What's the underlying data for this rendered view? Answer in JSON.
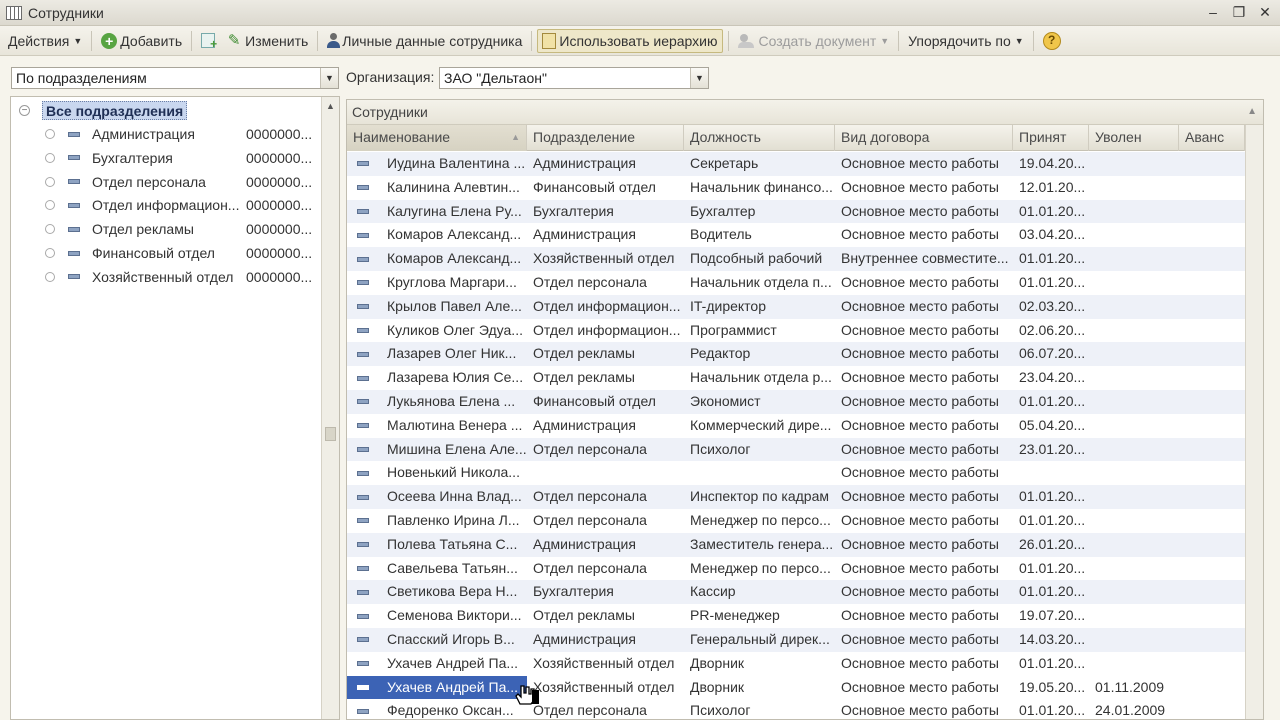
{
  "window": {
    "title": "Сотрудники"
  },
  "toolbar": {
    "actions": "Действия",
    "add": "Добавить",
    "edit": "Изменить",
    "personal_data": "Личные данные сотрудника",
    "use_hierarchy": "Использовать иерархию",
    "create_document": "Создать документ",
    "order_by": "Упорядочить по"
  },
  "filters": {
    "view_mode": "По подразделениям",
    "org_label": "Организация:",
    "org_value": "ЗАО \"Дельтаон\""
  },
  "tree": {
    "root": "Все подразделения",
    "items": [
      {
        "name": "Администрация",
        "code": "0000000..."
      },
      {
        "name": "Бухгалтерия",
        "code": "0000000..."
      },
      {
        "name": "Отдел персонала",
        "code": "0000000..."
      },
      {
        "name": "Отдел информацион...",
        "code": "0000000..."
      },
      {
        "name": "Отдел рекламы",
        "code": "0000000..."
      },
      {
        "name": "Финансовый отдел",
        "code": "0000000..."
      },
      {
        "name": "Хозяйственный отдел",
        "code": "0000000..."
      }
    ]
  },
  "grid": {
    "caption": "Сотрудники",
    "columns": [
      "Наименование",
      "Подразделение",
      "Должность",
      "Вид договора",
      "Принят",
      "Уволен",
      "Аванс"
    ],
    "rows": [
      [
        "Иудина Валентина ...",
        "Администрация",
        "Секретарь",
        "Основное место работы",
        "19.04.20...",
        "",
        ""
      ],
      [
        "Калинина Алевтин...",
        "Финансовый отдел",
        "Начальник финансо...",
        "Основное место работы",
        "12.01.20...",
        "",
        ""
      ],
      [
        "Калугина Елена Ру...",
        "Бухгалтерия",
        "Бухгалтер",
        "Основное место работы",
        "01.01.20...",
        "",
        ""
      ],
      [
        "Комаров Александ...",
        "Администрация",
        "Водитель",
        "Основное место работы",
        "03.04.20...",
        "",
        ""
      ],
      [
        "Комаров Александ...",
        "Хозяйственный отдел",
        "Подсобный рабочий",
        "Внутреннее совместите...",
        "01.01.20...",
        "",
        ""
      ],
      [
        "Круглова Маргари...",
        "Отдел персонала",
        "Начальник отдела п...",
        "Основное место работы",
        "01.01.20...",
        "",
        ""
      ],
      [
        "Крылов Павел Але...",
        "Отдел информацион...",
        "IT-директор",
        "Основное место работы",
        "02.03.20...",
        "",
        ""
      ],
      [
        "Куликов Олег Эдуа...",
        "Отдел информацион...",
        "Программист",
        "Основное место работы",
        "02.06.20...",
        "",
        ""
      ],
      [
        "Лазарев Олег Ник...",
        "Отдел рекламы",
        "Редактор",
        "Основное место работы",
        "06.07.20...",
        "",
        ""
      ],
      [
        "Лазарева Юлия Се...",
        "Отдел рекламы",
        "Начальник отдела р...",
        "Основное место работы",
        "23.04.20...",
        "",
        ""
      ],
      [
        "Лукьянова Елена ...",
        "Финансовый отдел",
        "Экономист",
        "Основное место работы",
        "01.01.20...",
        "",
        ""
      ],
      [
        "Малютина Венера ...",
        "Администрация",
        "Коммерческий дире...",
        "Основное место работы",
        "05.04.20...",
        "",
        ""
      ],
      [
        "Мишина Елена Але...",
        "Отдел персонала",
        "Психолог",
        "Основное место работы",
        "23.01.20...",
        "",
        ""
      ],
      [
        "Новенький Никола...",
        "",
        "",
        "Основное место работы",
        "",
        "",
        ""
      ],
      [
        "Осеева Инна Влад...",
        "Отдел персонала",
        "Инспектор по кадрам",
        "Основное место работы",
        "01.01.20...",
        "",
        ""
      ],
      [
        "Павленко Ирина Л...",
        "Отдел персонала",
        "Менеджер по персо...",
        "Основное место работы",
        "01.01.20...",
        "",
        ""
      ],
      [
        "Полева Татьяна С...",
        "Администрация",
        "Заместитель генера...",
        "Основное место работы",
        "26.01.20...",
        "",
        ""
      ],
      [
        "Савельева Татьян...",
        "Отдел персонала",
        "Менеджер по персо...",
        "Основное место работы",
        "01.01.20...",
        "",
        ""
      ],
      [
        "Светикова Вера Н...",
        "Бухгалтерия",
        "Кассир",
        "Основное место работы",
        "01.01.20...",
        "",
        ""
      ],
      [
        "Семенова Виктори...",
        "Отдел рекламы",
        "PR-менеджер",
        "Основное место работы",
        "19.07.20...",
        "",
        ""
      ],
      [
        "Спасский Игорь В...",
        "Администрация",
        "Генеральный дирек...",
        "Основное место работы",
        "14.03.20...",
        "",
        ""
      ],
      [
        "Ухачев Андрей Па...",
        "Хозяйственный отдел",
        "Дворник",
        "Основное место работы",
        "01.01.20...",
        "",
        ""
      ],
      [
        "Ухачев Андрей Па...",
        "Хозяйственный отдел",
        "Дворник",
        "Основное место работы",
        "19.05.20...",
        "01.11.2009",
        ""
      ],
      [
        "Федоренко Оксан...",
        "Отдел персонала",
        "Психолог",
        "Основное место работы",
        "01.01.20...",
        "24.01.2009",
        ""
      ]
    ],
    "selected_row": 22
  },
  "colors": {
    "selection": "#3c63b5",
    "row_alt": "#eef1f8",
    "tree_root_highlight": "#c9d7ef"
  }
}
